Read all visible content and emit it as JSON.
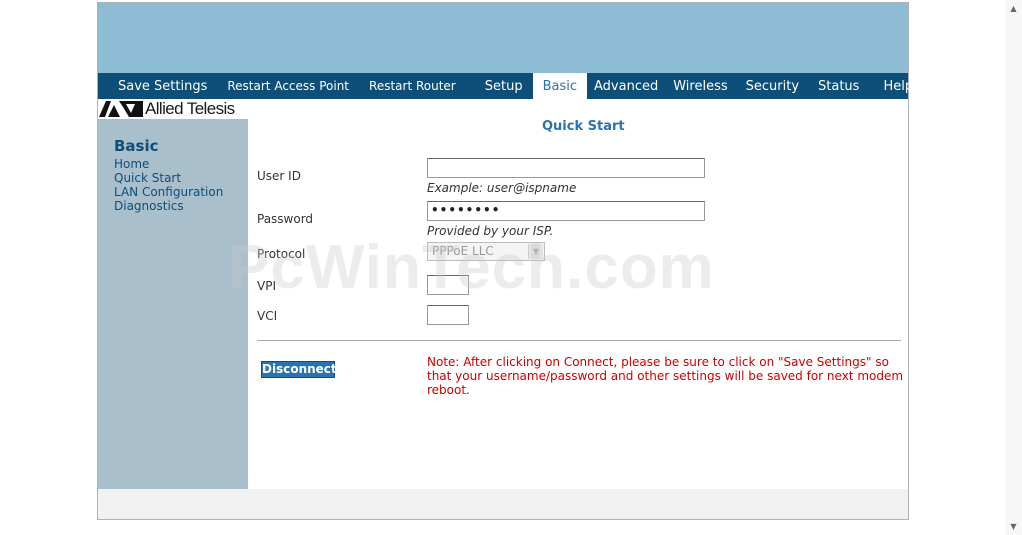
{
  "nav": {
    "items": [
      {
        "label": "Save Settings"
      },
      {
        "label": "Restart Access Point"
      },
      {
        "label": "Restart Router"
      },
      {
        "label": "Setup"
      },
      {
        "label": "Basic"
      },
      {
        "label": "Advanced"
      },
      {
        "label": "Wireless"
      },
      {
        "label": "Security"
      },
      {
        "label": "Status"
      },
      {
        "label": "Help"
      }
    ],
    "active": "Basic"
  },
  "brand": {
    "logo_text": "Allied Telesis"
  },
  "sidebar": {
    "heading": "Basic",
    "items": [
      "Home",
      "Quick Start",
      "LAN Configuration",
      "Diagnostics"
    ]
  },
  "main": {
    "title": "Quick Start",
    "user_id": {
      "label": "User ID",
      "value": "",
      "hint": "Example: user@ispname"
    },
    "password": {
      "label": "Password",
      "value": "••••••••",
      "hint": "Provided by your ISP."
    },
    "protocol": {
      "label": "Protocol",
      "selected": "PPPoE LLC"
    },
    "vpi": {
      "label": "VPI",
      "value": ""
    },
    "vci": {
      "label": "VCI",
      "value": ""
    },
    "disconnect_label": "Disconnect",
    "note": "Note: After clicking on Connect, please be sure to click on \"Save Settings\" so that your username/password and other settings will be saved for next modem reboot."
  },
  "watermark": "PcWinTech.com",
  "colors": {
    "nav_bg": "#0d4f79",
    "banner": "#8dbcd4",
    "sidebar_bg": "#aabfcc",
    "accent": "#2a73b0",
    "note": "#cc0000"
  }
}
